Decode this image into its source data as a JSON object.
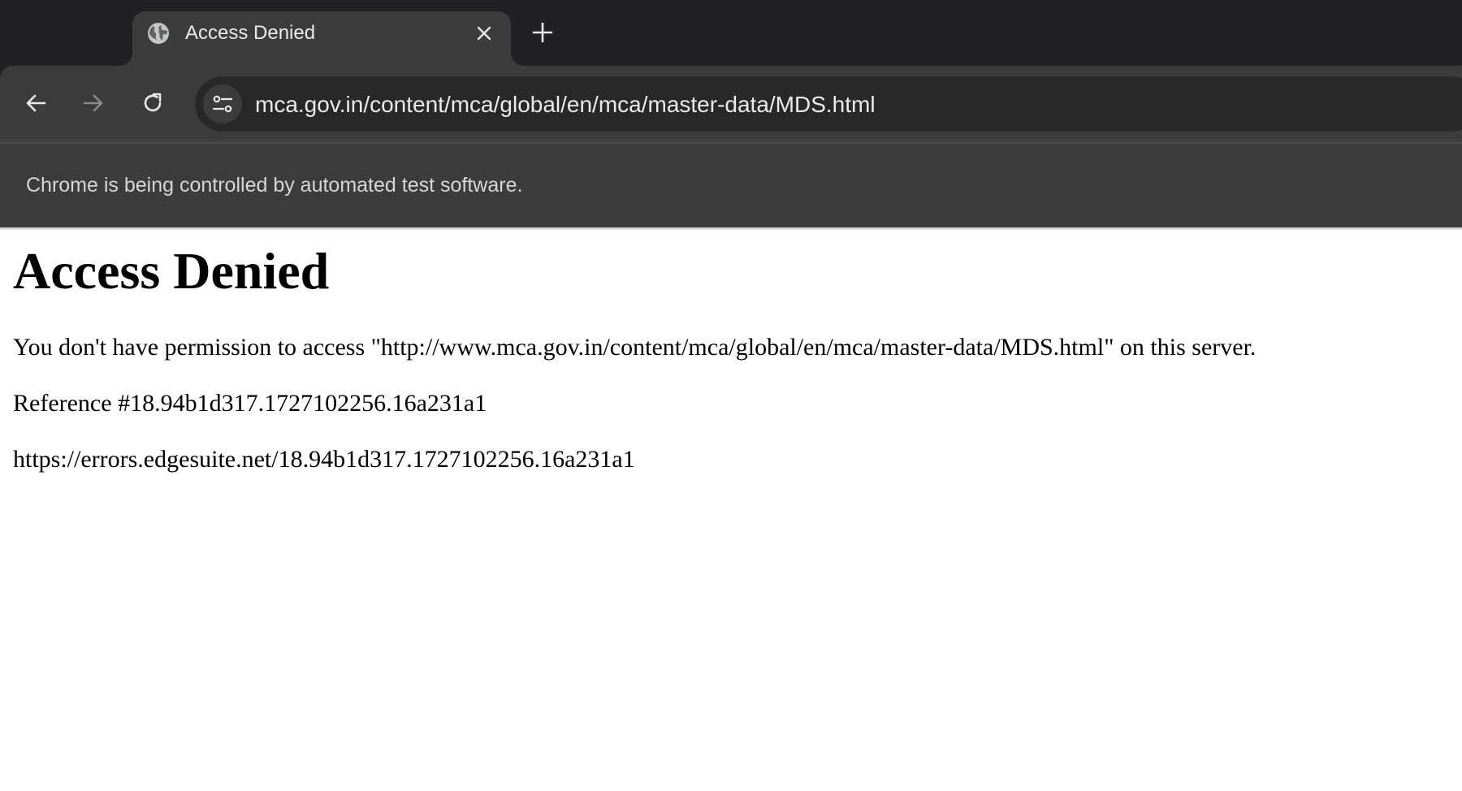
{
  "browser": {
    "tab": {
      "title": "Access Denied",
      "favicon": "globe-icon",
      "close_icon": "close-icon"
    },
    "new_tab_icon": "plus-icon",
    "toolbar": {
      "back_icon": "arrow-left-icon",
      "forward_icon": "arrow-right-icon",
      "reload_icon": "reload-icon",
      "site_info_icon": "tune-icon",
      "url": "mca.gov.in/content/mca/global/en/mca/master-data/MDS.html"
    },
    "infobar": {
      "text": "Chrome is being controlled by automated test software."
    },
    "colors": {
      "tabstrip_bg": "#202124",
      "toolbar_bg": "#3c3c3c",
      "omnibox_bg": "#282828",
      "text_light": "#e8eaed",
      "forward_disabled": "#8a8a8a"
    }
  },
  "page": {
    "heading": "Access Denied",
    "message": "You don't have permission to access \"http://www.mca.gov.in/content/mca/global/en/mca/master-data/MDS.html\" on this server.",
    "reference": "Reference #18.94b1d317.1727102256.16a231a1",
    "error_url": "https://errors.edgesuite.net/18.94b1d317.1727102256.16a231a1"
  }
}
